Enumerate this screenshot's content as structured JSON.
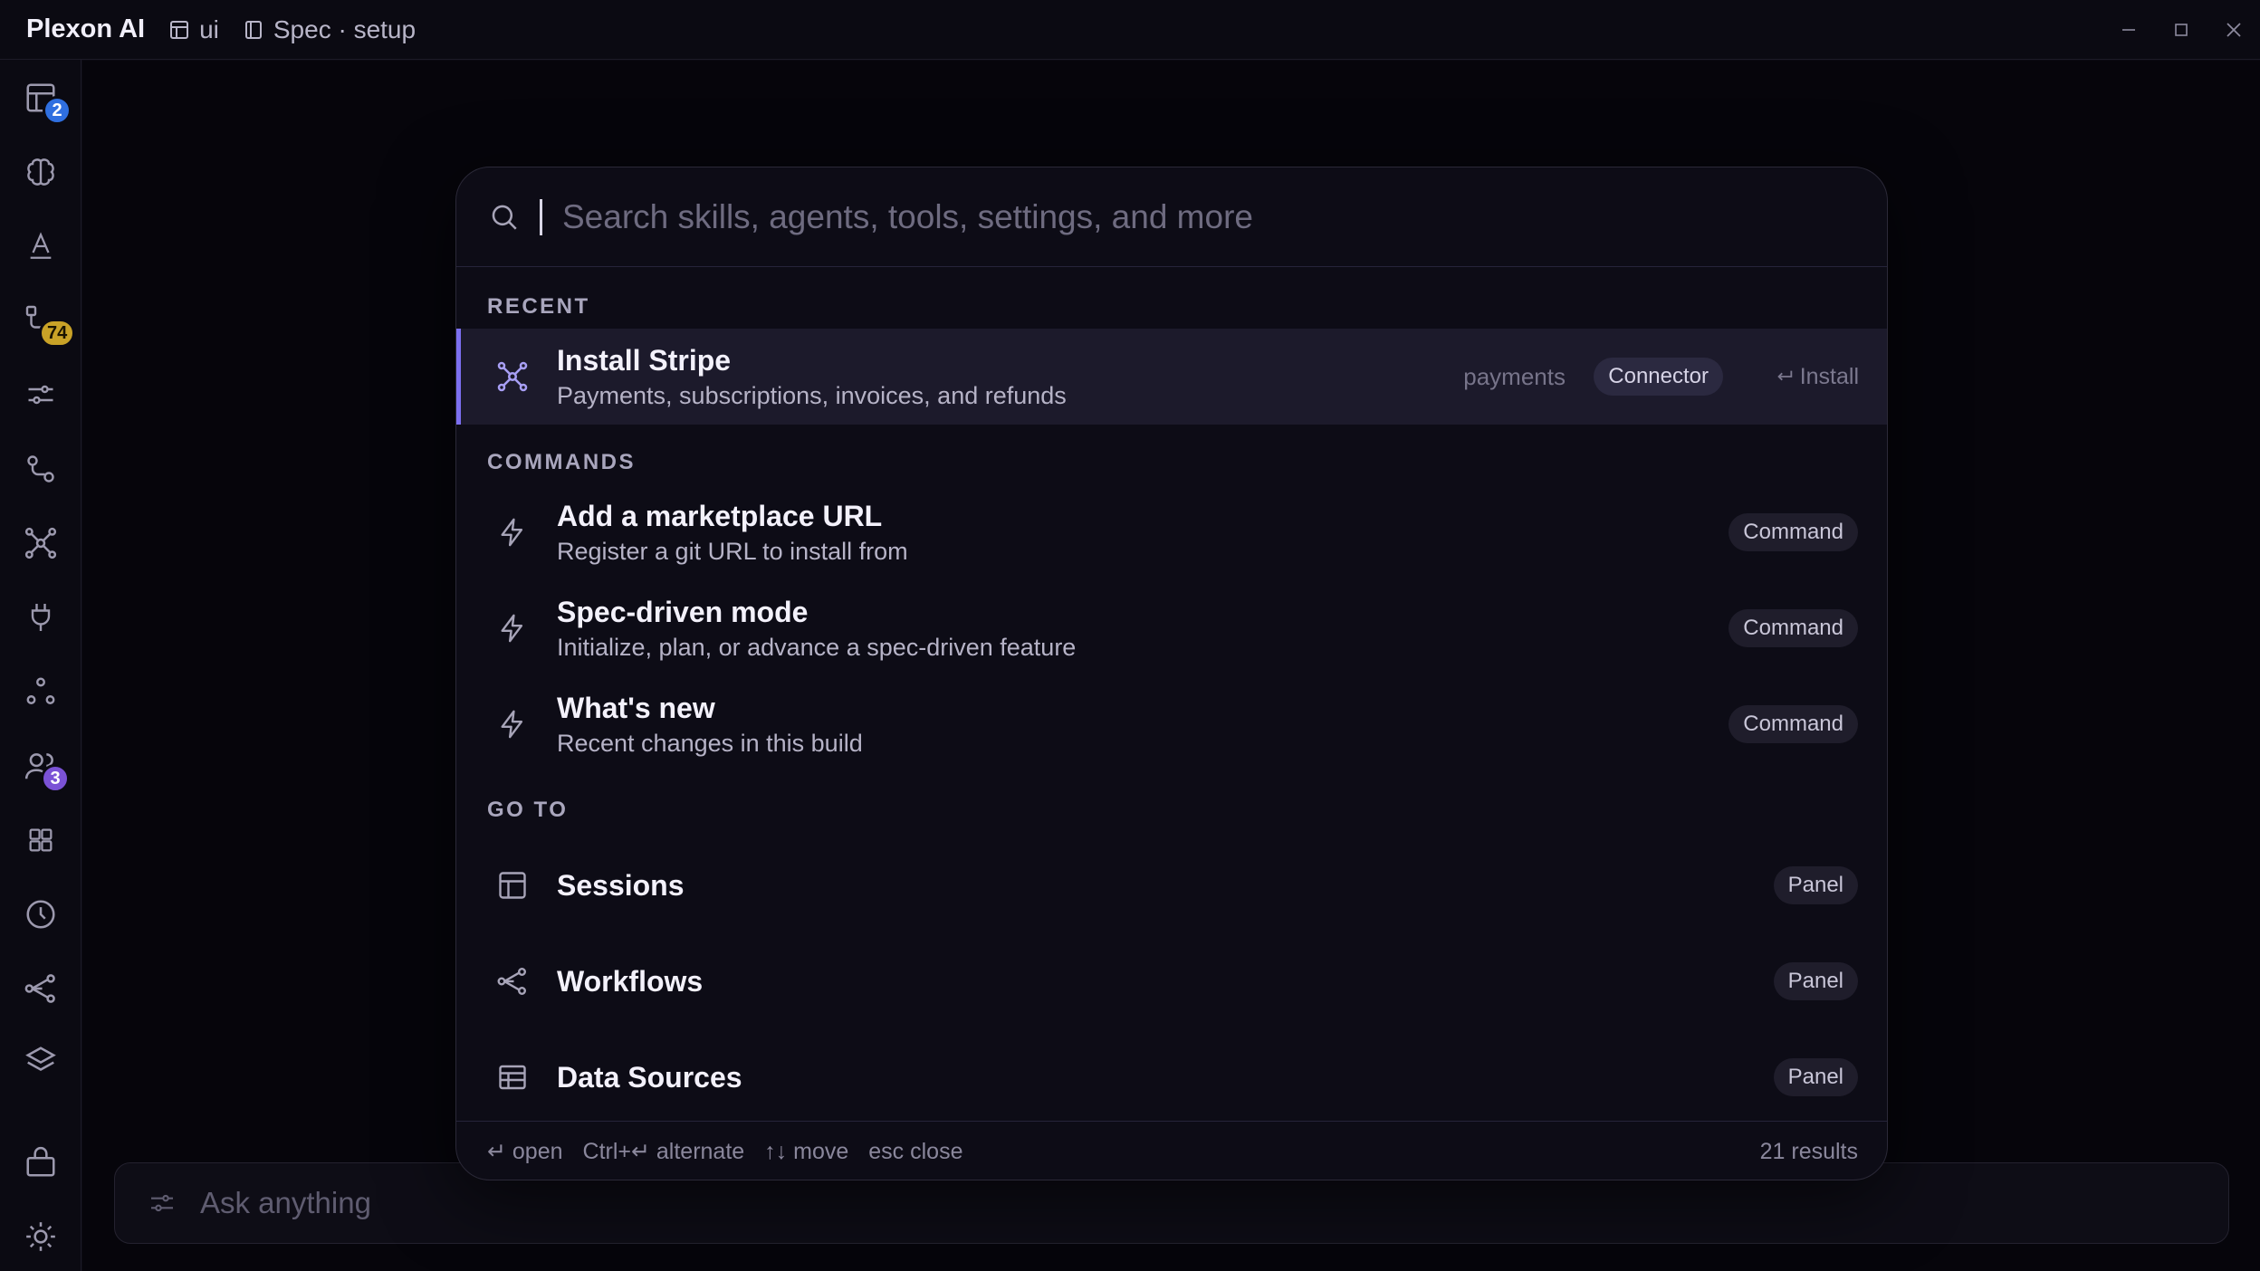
{
  "titlebar": {
    "app_name": "Plexon AI",
    "crumb1": "ui",
    "crumb2": "Spec · setup"
  },
  "sidebar": {
    "badges": {
      "sessions": "2",
      "workflow": "74",
      "team": "3"
    },
    "colors": {
      "badge_blue": "#2f6fe0",
      "badge_yellow": "#c9a227",
      "badge_purple": "#7b52d6"
    }
  },
  "palette": {
    "search_placeholder": "Search skills, agents, tools, settings, and more",
    "sections": {
      "recent": "RECENT",
      "commands": "COMMANDS",
      "goto": "GO TO"
    },
    "recent": [
      {
        "title": "Install Stripe",
        "subtitle": "Payments, subscriptions, invoices, and refunds",
        "tag": "payments",
        "kind": "Connector",
        "action": "Install",
        "icon": "connector-icon"
      }
    ],
    "commands": [
      {
        "title": "Add a marketplace URL",
        "subtitle": "Register a git URL to install from",
        "kind": "Command",
        "icon": "bolt-icon"
      },
      {
        "title": "Spec-driven mode",
        "subtitle": "Initialize, plan, or advance a spec-driven feature",
        "kind": "Command",
        "icon": "bolt-icon"
      },
      {
        "title": "What's new",
        "subtitle": "Recent changes in this build",
        "kind": "Command",
        "icon": "bolt-icon"
      }
    ],
    "goto": [
      {
        "title": "Sessions",
        "kind": "Panel",
        "icon": "layout-icon"
      },
      {
        "title": "Workflows",
        "kind": "Panel",
        "icon": "share-icon"
      },
      {
        "title": "Data Sources",
        "kind": "Panel",
        "icon": "table-icon"
      }
    ],
    "footer": {
      "open": "↵ open",
      "alternate": "Ctrl+↵ alternate",
      "move": "↑↓ move",
      "close": "esc close",
      "results": "21 results"
    },
    "accent": "#7c6ff0"
  },
  "ask": {
    "placeholder": "Ask anything"
  }
}
